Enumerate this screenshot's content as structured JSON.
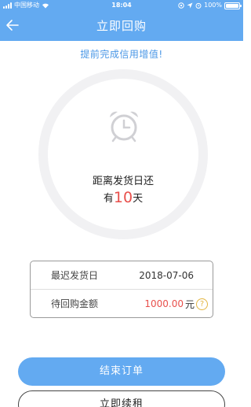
{
  "status_bar": {
    "carrier": "中国移动",
    "time": "18:04",
    "battery": "100%"
  },
  "nav": {
    "title": "立即回购",
    "back_icon": "arrow-left-icon"
  },
  "subtitle": "提前完成信用增值!",
  "countdown": {
    "label": "距离发货日还",
    "prefix": "有",
    "days": "10",
    "suffix": "天"
  },
  "info": {
    "rows": [
      {
        "label": "最迟发货日",
        "value": "2018-07-06"
      },
      {
        "label": "待回购金额",
        "value": "1000.00",
        "unit": "元"
      }
    ],
    "help_symbol": "?"
  },
  "buttons": {
    "end_order": "结束订单",
    "renew": "立即续租"
  },
  "colors": {
    "primary": "#63aaf1",
    "accent_red": "#e8504c",
    "help_yellow": "#e3b540",
    "subtitle_blue": "#4a97e6"
  }
}
